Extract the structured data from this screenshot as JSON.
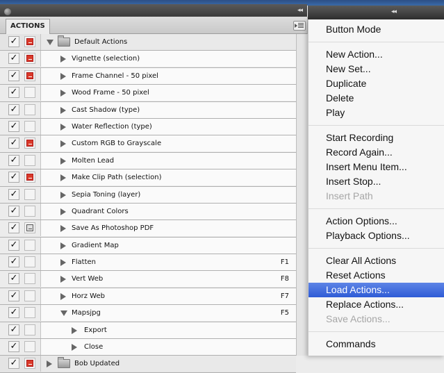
{
  "panel": {
    "tab_label": "ACTIONS",
    "rows": [
      {
        "label": "Default Actions",
        "kind": "set",
        "expanded": true,
        "checked": true,
        "dialog": "red",
        "fkey": ""
      },
      {
        "label": "Vignette (selection)",
        "kind": "action",
        "expanded": false,
        "checked": true,
        "dialog": "red",
        "fkey": ""
      },
      {
        "label": "Frame Channel - 50 pixel",
        "kind": "action",
        "expanded": false,
        "checked": true,
        "dialog": "red",
        "fkey": ""
      },
      {
        "label": "Wood Frame - 50 pixel",
        "kind": "action",
        "expanded": false,
        "checked": true,
        "dialog": "none",
        "fkey": ""
      },
      {
        "label": "Cast Shadow (type)",
        "kind": "action",
        "expanded": false,
        "checked": true,
        "dialog": "none",
        "fkey": ""
      },
      {
        "label": "Water Reflection (type)",
        "kind": "action",
        "expanded": false,
        "checked": true,
        "dialog": "none",
        "fkey": ""
      },
      {
        "label": "Custom RGB to Grayscale",
        "kind": "action",
        "expanded": false,
        "checked": true,
        "dialog": "red",
        "fkey": ""
      },
      {
        "label": "Molten Lead",
        "kind": "action",
        "expanded": false,
        "checked": true,
        "dialog": "none",
        "fkey": ""
      },
      {
        "label": "Make Clip Path (selection)",
        "kind": "action",
        "expanded": false,
        "checked": true,
        "dialog": "red",
        "fkey": ""
      },
      {
        "label": "Sepia Toning (layer)",
        "kind": "action",
        "expanded": false,
        "checked": true,
        "dialog": "none",
        "fkey": ""
      },
      {
        "label": "Quadrant Colors",
        "kind": "action",
        "expanded": false,
        "checked": true,
        "dialog": "none",
        "fkey": ""
      },
      {
        "label": "Save As Photoshop PDF",
        "kind": "action",
        "expanded": false,
        "checked": true,
        "dialog": "gray",
        "fkey": ""
      },
      {
        "label": "Gradient Map",
        "kind": "action",
        "expanded": false,
        "checked": true,
        "dialog": "none",
        "fkey": ""
      },
      {
        "label": "Flatten",
        "kind": "action",
        "expanded": false,
        "checked": true,
        "dialog": "none",
        "fkey": "F1"
      },
      {
        "label": "Vert Web",
        "kind": "action",
        "expanded": false,
        "checked": true,
        "dialog": "none",
        "fkey": "F8"
      },
      {
        "label": "Horz Web",
        "kind": "action",
        "expanded": false,
        "checked": true,
        "dialog": "none",
        "fkey": "F7"
      },
      {
        "label": "Mapsjpg",
        "kind": "action",
        "expanded": true,
        "checked": true,
        "dialog": "none",
        "fkey": "F5"
      },
      {
        "label": "Export",
        "kind": "step",
        "expanded": false,
        "checked": true,
        "dialog": "none",
        "fkey": ""
      },
      {
        "label": "Close",
        "kind": "step",
        "expanded": false,
        "checked": true,
        "dialog": "none",
        "fkey": ""
      },
      {
        "label": "Bob Updated",
        "kind": "set",
        "expanded": false,
        "checked": true,
        "dialog": "red",
        "fkey": ""
      }
    ]
  },
  "menu": {
    "groups": [
      [
        {
          "label": "Button Mode",
          "disabled": false
        }
      ],
      [
        {
          "label": "New Action...",
          "disabled": false
        },
        {
          "label": "New Set...",
          "disabled": false
        },
        {
          "label": "Duplicate",
          "disabled": false
        },
        {
          "label": "Delete",
          "disabled": false
        },
        {
          "label": "Play",
          "disabled": false
        }
      ],
      [
        {
          "label": "Start Recording",
          "disabled": false
        },
        {
          "label": "Record Again...",
          "disabled": false
        },
        {
          "label": "Insert Menu Item...",
          "disabled": false
        },
        {
          "label": "Insert Stop...",
          "disabled": false
        },
        {
          "label": "Insert Path",
          "disabled": true
        }
      ],
      [
        {
          "label": "Action Options...",
          "disabled": false
        },
        {
          "label": "Playback Options...",
          "disabled": false
        }
      ],
      [
        {
          "label": "Clear All Actions",
          "disabled": false
        },
        {
          "label": "Reset Actions",
          "disabled": false
        },
        {
          "label": "Load Actions...",
          "disabled": false,
          "highlighted": true
        },
        {
          "label": "Replace Actions...",
          "disabled": false
        },
        {
          "label": "Save Actions...",
          "disabled": true
        }
      ],
      [
        {
          "label": "Commands",
          "disabled": false
        }
      ]
    ]
  },
  "colors": {
    "dialog_red": "#d93a2a",
    "menu_highlight": "#2f5cd6",
    "disabled_text": "#a6a6a6"
  },
  "icons": [
    "checkmark-icon",
    "dialog-toggle-icon",
    "disclosure-triangle-icon",
    "folder-icon",
    "panel-menu-icon",
    "collapse-icon"
  ]
}
